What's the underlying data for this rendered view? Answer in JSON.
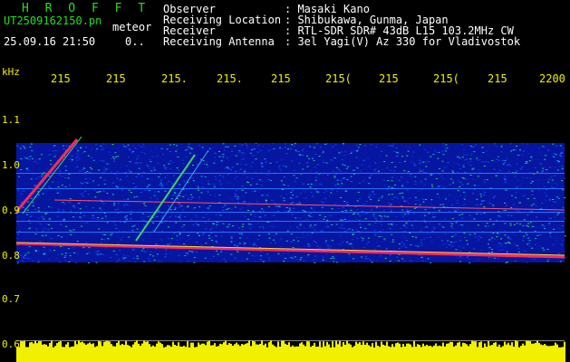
{
  "header": {
    "program": "H R O F F T",
    "filename": "UT2509162150.pn",
    "mode": "meteor",
    "datetime": "25.09.16 21:50",
    "count": "0..",
    "info": [
      {
        "label": "Observer",
        "value": "Masaki Kano"
      },
      {
        "label": "Receiving Location",
        "value": "Shibukawa, Gunma, Japan"
      },
      {
        "label": "Receiver",
        "value": "RTL-SDR SDR# 43dB L15 103.2MHz CW"
      },
      {
        "label": "Receiving Antenna",
        "value": "3el Yagi(V) Az 330 for Vladivostok"
      }
    ]
  },
  "axis": {
    "unit": "kHz",
    "time_ticks": [
      "215",
      "215",
      "215.",
      "215.",
      "215",
      "215(",
      "215",
      "215(",
      "215",
      "2200"
    ],
    "freq_labels": [
      "1.1",
      "1.0",
      "0.9",
      "0.8",
      "0.7",
      "0.6"
    ]
  },
  "colors": {
    "header_green": "#20e020",
    "axis_yellow": "#f0f000",
    "carrier_red": "#ff2a55",
    "noise_blue": "#0a1fd0",
    "baseline_yellow": "#f0f000"
  }
}
